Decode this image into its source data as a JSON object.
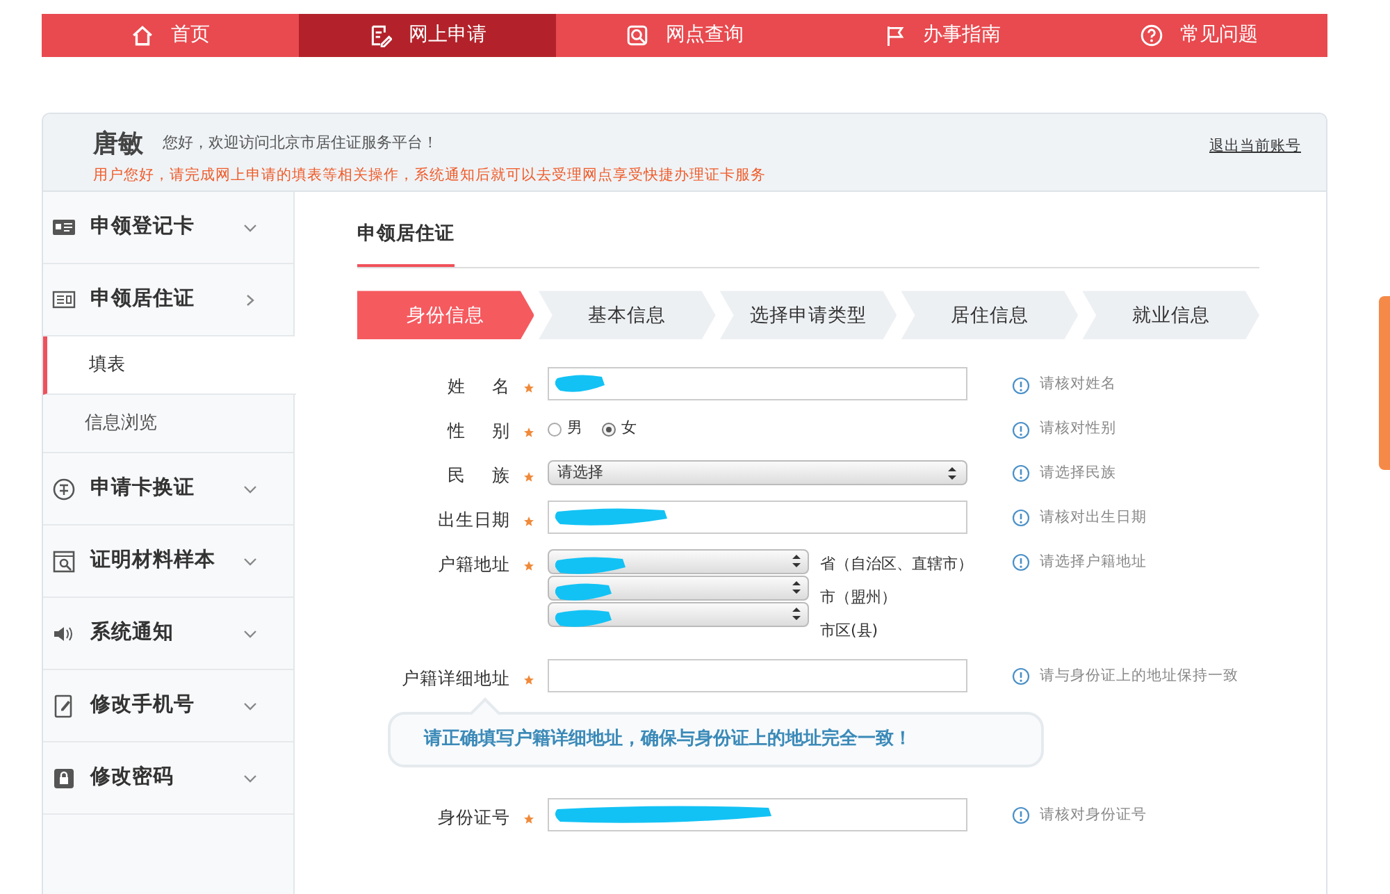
{
  "nav": [
    {
      "label": "首页",
      "selected": false
    },
    {
      "label": "网上申请",
      "selected": true
    },
    {
      "label": "网点查询",
      "selected": false
    },
    {
      "label": "办事指南",
      "selected": false
    },
    {
      "label": "常见问题",
      "selected": false
    }
  ],
  "header": {
    "name": "唐敏",
    "welcome": "您好，欢迎访问北京市居住证服务平台！",
    "notice": "用户您好，请完成网上申请的填表等相关操作，系统通知后就可以去受理网点享受快捷办理证卡服务",
    "logout": "退出当前账号"
  },
  "sidebar": [
    {
      "label": "申领登记卡",
      "expanded": false
    },
    {
      "label": "申领居住证",
      "expanded": true,
      "children": [
        {
          "label": "填表",
          "selected": true
        },
        {
          "label": "信息浏览",
          "selected": false
        }
      ]
    },
    {
      "label": "申请卡换证",
      "expanded": false
    },
    {
      "label": "证明材料样本",
      "expanded": false
    },
    {
      "label": "系统通知",
      "expanded": false
    },
    {
      "label": "修改手机号",
      "expanded": false
    },
    {
      "label": "修改密码",
      "expanded": false
    }
  ],
  "section_title": "申领居住证",
  "steps": [
    {
      "label": "身份信息",
      "selected": true
    },
    {
      "label": "基本信息",
      "selected": false
    },
    {
      "label": "选择申请类型",
      "selected": false
    },
    {
      "label": "居住信息",
      "selected": false
    },
    {
      "label": "就业信息",
      "selected": false
    }
  ],
  "form": [
    {
      "kind": "text",
      "label": "姓 名",
      "required": true,
      "redacted": true,
      "hint": "请核对姓名"
    },
    {
      "kind": "radio",
      "label": "性 别",
      "required": true,
      "options": [
        {
          "label": "男",
          "selected": false
        },
        {
          "label": "女",
          "selected": true
        }
      ],
      "hint": "请核对性别"
    },
    {
      "kind": "select",
      "label": "民 族",
      "required": true,
      "value": "请选择",
      "hint": "请选择民族"
    },
    {
      "kind": "text",
      "label": "出生日期",
      "required": true,
      "redacted": true,
      "hint": "请核对出生日期"
    },
    {
      "kind": "address",
      "label": "户籍地址",
      "required": true,
      "selects": [
        {
          "suffix": "省（自治区、直辖市）",
          "redacted": true
        },
        {
          "suffix": "市（盟州）",
          "redacted": true
        },
        {
          "suffix": "市区(县)",
          "redacted": true
        }
      ],
      "hint": "请选择户籍地址"
    },
    {
      "kind": "text",
      "label": "户籍详细地址",
      "required": true,
      "redacted": false,
      "hint": "请与身份证上的地址保持一致",
      "tooltip": "请正确填写户籍详细地址，确保与身份证上的地址完全一致！"
    },
    {
      "kind": "text",
      "label": "身份证号",
      "required": true,
      "redacted": true,
      "hint": "请核对身份证号"
    }
  ]
}
